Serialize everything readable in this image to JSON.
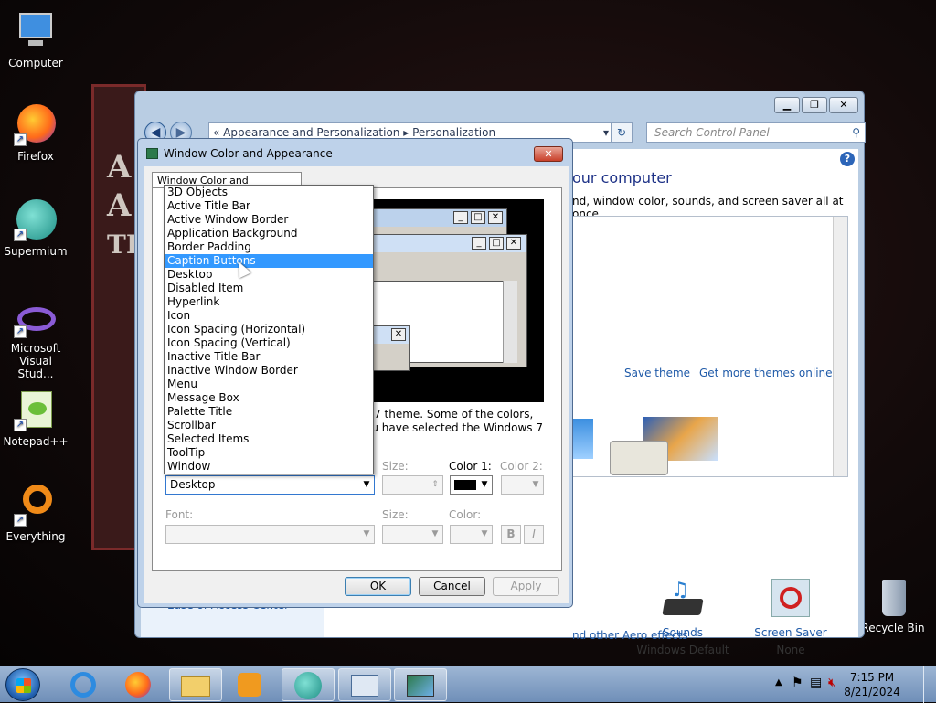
{
  "desktop": {
    "icons": [
      {
        "label": "Computer"
      },
      {
        "label": "Firefox"
      },
      {
        "label": "Supermium"
      },
      {
        "label": "Microsoft Visual Stud..."
      },
      {
        "label": "Notepad++"
      },
      {
        "label": "Everything"
      },
      {
        "label": "Recycle Bin"
      }
    ]
  },
  "control_panel": {
    "breadcrumb": {
      "sep": "«",
      "part1": "Appearance and Personalization",
      "part2": "Personalization"
    },
    "search_placeholder": "Search Control Panel",
    "heading": "our computer",
    "subheading": "nd, window color, sounds, and screen saver all at once.",
    "save_theme": "Save theme",
    "get_more_themes": "Get more themes online",
    "sounds_label": "Sounds",
    "sounds_value": "Windows Default",
    "screen_saver_label": "Screen Saver",
    "screen_saver_value": "None",
    "aero_link": "nd other Aero effects",
    "ease_link": "Ease of Access Center"
  },
  "dialog": {
    "title": "Window Color and Appearance",
    "tab_label": "Window Color and Appearance",
    "description_line1": "s 7 theme.  Some of the colors,",
    "description_line2": "ou have selected the Windows 7",
    "size_label": "Size:",
    "color1_label": "Color 1:",
    "color2_label": "Color 2:",
    "item_value": "Desktop",
    "font_label": "Font:",
    "font_size_label": "Size:",
    "font_color_label": "Color:",
    "bold_label": "B",
    "italic_label": "I",
    "ok": "OK",
    "cancel": "Cancel",
    "apply": "Apply"
  },
  "dropdown_items": [
    "3D Objects",
    "Active Title Bar",
    "Active Window Border",
    "Application Background",
    "Border Padding",
    "Caption Buttons",
    "Desktop",
    "Disabled Item",
    "Hyperlink",
    "Icon",
    "Icon Spacing (Horizontal)",
    "Icon Spacing (Vertical)",
    "Inactive Title Bar",
    "Inactive Window Border",
    "Menu",
    "Message Box",
    "Palette Title",
    "Scrollbar",
    "Selected Items",
    "ToolTip",
    "Window"
  ],
  "dropdown_highlighted": "Caption Buttons",
  "taskbar": {
    "time": "7:15 PM",
    "date": "8/21/2024"
  },
  "colors": {
    "accent": "#3399ff",
    "link": "#1f5aa8",
    "color1_swatch": "#000000"
  }
}
